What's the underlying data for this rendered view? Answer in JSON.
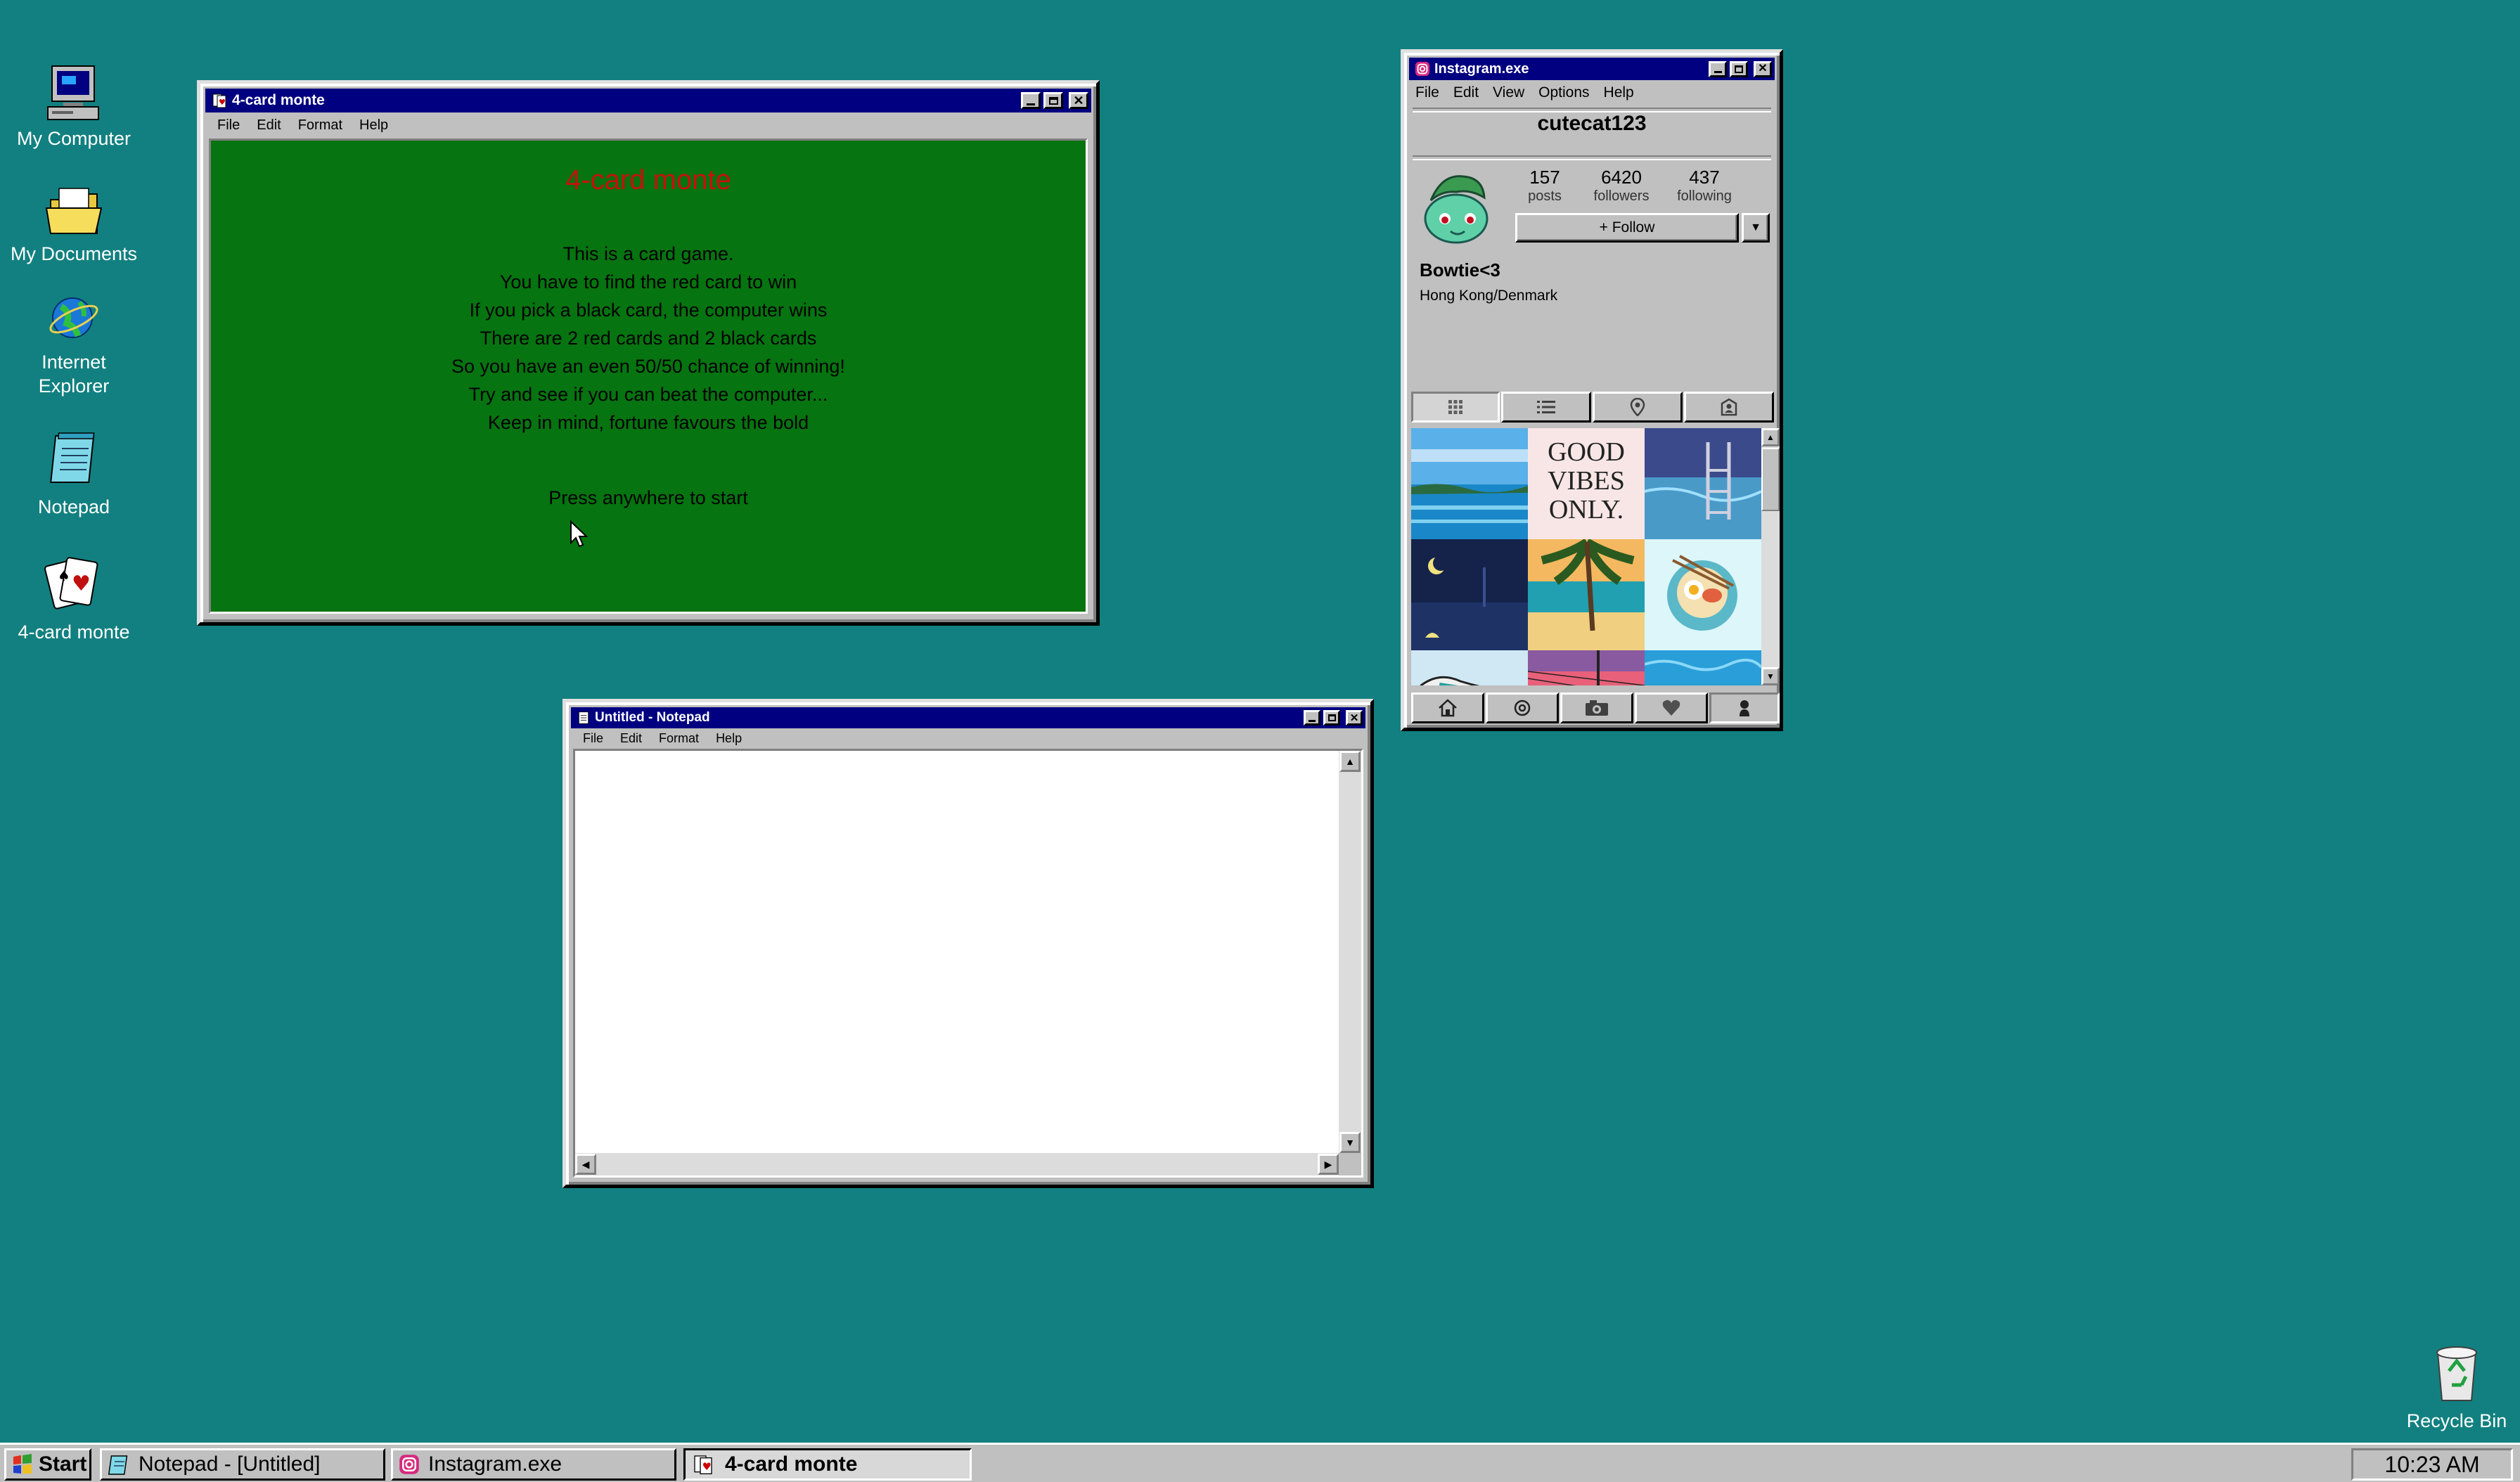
{
  "desktop": {
    "icons": [
      {
        "label": "My Computer",
        "icon": "computer-icon"
      },
      {
        "label": "My Documents",
        "icon": "folder-icon"
      },
      {
        "label": "Internet Explorer",
        "icon": "globe-icon"
      },
      {
        "label": "Notepad",
        "icon": "notepad-icon"
      },
      {
        "label": "4-card monte",
        "icon": "cards-icon"
      }
    ],
    "recycle_bin": "Recycle Bin"
  },
  "card_window": {
    "title": "4-card monte",
    "menu": [
      "File",
      "Edit",
      "Format",
      "Help"
    ],
    "heading": "4-card monte",
    "lines": [
      "This is a card game.",
      "You have to find the red card to win",
      "If you pick a black card, the computer wins",
      "There are 2 red cards and 2 black cards",
      "So you have an even 50/50 chance of winning!",
      "Try and see if you can beat the computer...",
      "Keep in mind, fortune favours the bold"
    ],
    "start_prompt": "Press anywhere to start"
  },
  "notepad_window": {
    "title": "Untitled - Notepad",
    "menu": [
      "File",
      "Edit",
      "Format",
      "Help"
    ],
    "content": ""
  },
  "instagram_window": {
    "title": "Instagram.exe",
    "menu": [
      "File",
      "Edit",
      "View",
      "Options",
      "Help"
    ],
    "username": "cutecat123",
    "stats": {
      "posts": "157",
      "posts_label": "posts",
      "followers": "6420",
      "followers_label": "followers",
      "following": "437",
      "following_label": "following"
    },
    "follow_label": "+ Follow",
    "display_name": "Bowtie<3",
    "location": "Hong Kong/Denmark",
    "quote_post": "GOOD VIBES ONLY."
  },
  "taskbar": {
    "start_label": "Start",
    "buttons": [
      "Notepad - [Untitled]",
      "Instagram.exe",
      "4-card monte"
    ],
    "clock": "10:23 AM"
  },
  "colors": {
    "desktop": "#128080",
    "titlebar": "#000080",
    "game_felt": "#067410",
    "game_heading": "#c8100a"
  }
}
